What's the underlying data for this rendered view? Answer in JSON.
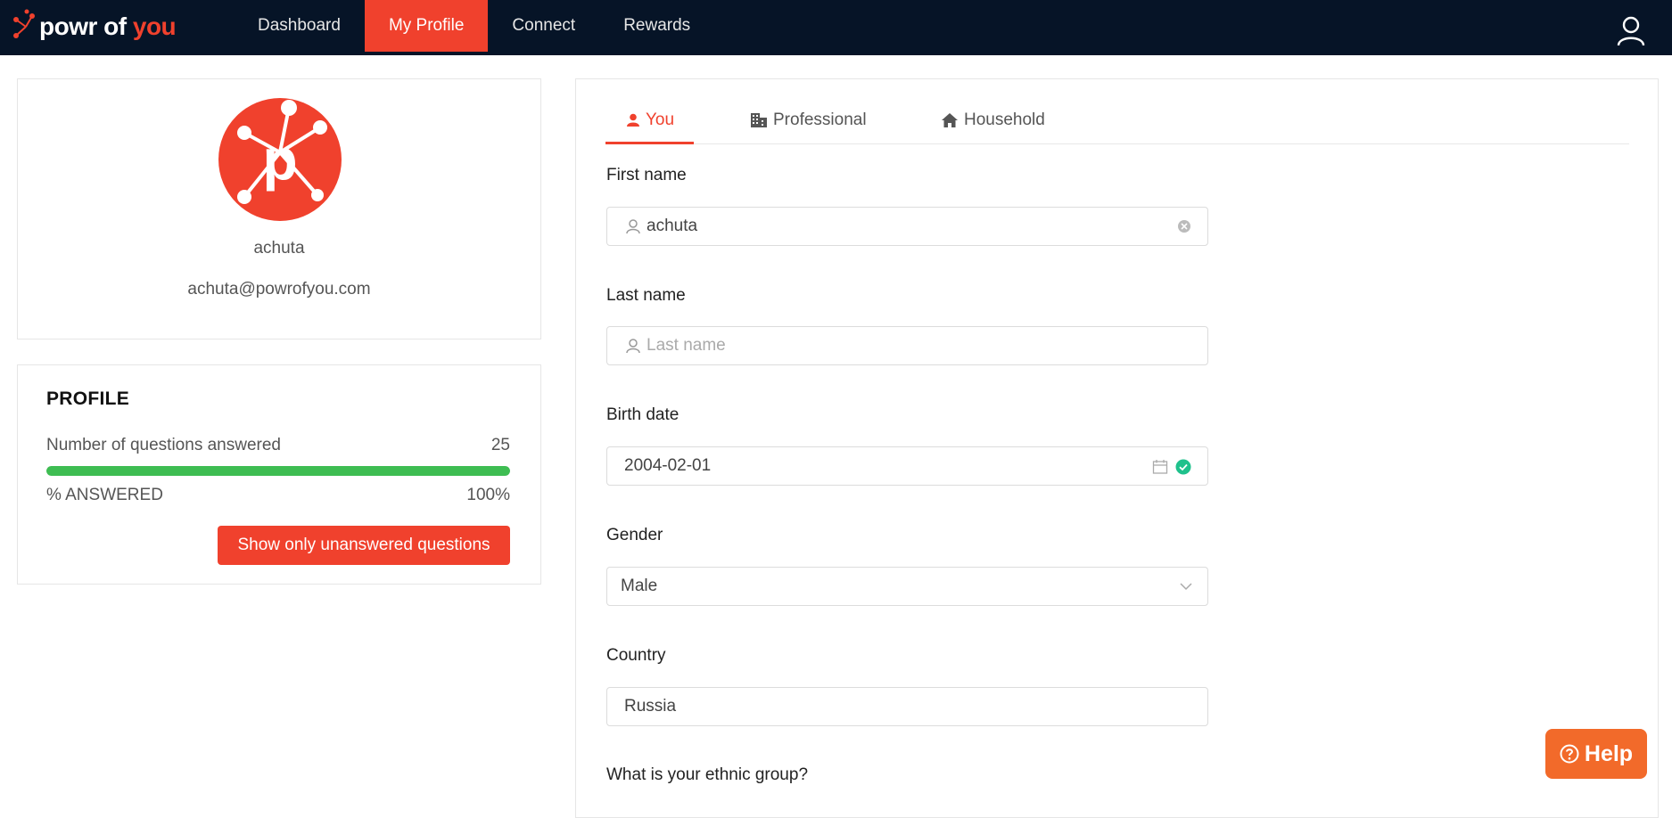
{
  "brand": {
    "logo_text_part1": "powr of",
    "logo_text_part2": "you",
    "accent": "#f0412d",
    "nav_bg": "#061427"
  },
  "nav": {
    "items": [
      {
        "label": "Dashboard"
      },
      {
        "label": "My Profile",
        "active": true
      },
      {
        "label": "Connect"
      },
      {
        "label": "Rewards"
      }
    ],
    "user_icon": "user-icon"
  },
  "user_card": {
    "username": "achuta",
    "email": "achuta@powrofyou.com"
  },
  "profile_card": {
    "title": "PROFILE",
    "questions_label": "Number of questions answered",
    "questions_value": "25",
    "answered_label": "% ANSWERED",
    "answered_value": "100%",
    "progress": 1.0,
    "button_label": "Show only unanswered questions"
  },
  "tabs": [
    {
      "label": "You",
      "icon": "person-icon",
      "active": true
    },
    {
      "label": "Professional",
      "icon": "building-icon"
    },
    {
      "label": "Household",
      "icon": "home-icon"
    }
  ],
  "form": {
    "first_name": {
      "label": "First name",
      "value": "achuta"
    },
    "last_name": {
      "label": "Last name",
      "placeholder": "Last name"
    },
    "birth_date": {
      "label": "Birth date",
      "value": "2004-02-01"
    },
    "gender": {
      "label": "Gender",
      "value": "Male"
    },
    "country": {
      "label": "Country",
      "value": "Russia"
    },
    "ethnic": {
      "label": "What is your ethnic group?"
    }
  },
  "help": {
    "label": "Help"
  }
}
